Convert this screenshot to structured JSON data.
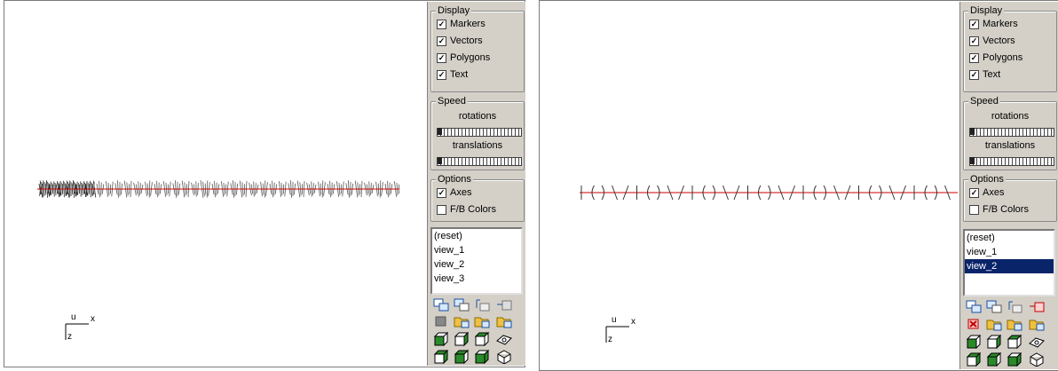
{
  "panels": [
    {
      "display": {
        "title": "Display",
        "items": [
          {
            "label": "Markers",
            "checked": true
          },
          {
            "label": "Vectors",
            "checked": true
          },
          {
            "label": "Polygons",
            "checked": true
          },
          {
            "label": "Text",
            "checked": true
          }
        ]
      },
      "speed": {
        "title": "Speed",
        "rotations_label": "rotations",
        "translations_label": "translations"
      },
      "options": {
        "title": "Options",
        "items": [
          {
            "label": "Axes",
            "checked": true
          },
          {
            "label": "F/B Colors",
            "checked": false
          }
        ]
      },
      "views": [
        "(reset)",
        "view_1",
        "view_2",
        "view_3"
      ],
      "selected_view": null,
      "axes": {
        "x": "x",
        "y": "u",
        "z": "z"
      }
    },
    {
      "display": {
        "title": "Display",
        "items": [
          {
            "label": "Markers",
            "checked": true
          },
          {
            "label": "Vectors",
            "checked": true
          },
          {
            "label": "Polygons",
            "checked": true
          },
          {
            "label": "Text",
            "checked": true
          }
        ]
      },
      "speed": {
        "title": "Speed",
        "rotations_label": "rotations",
        "translations_label": "translations"
      },
      "options": {
        "title": "Options",
        "items": [
          {
            "label": "Axes",
            "checked": true
          },
          {
            "label": "F/B Colors",
            "checked": false
          }
        ]
      },
      "views": [
        "(reset)",
        "view_1",
        "view_2"
      ],
      "selected_view": "view_2",
      "axes": {
        "x": "x",
        "y": "u",
        "z": "z"
      }
    }
  ],
  "check_glyph": "✓",
  "colors": {
    "panel_bg": "#d4d0c8",
    "selection": "#0a246a",
    "axis_line": "#cc0000"
  }
}
